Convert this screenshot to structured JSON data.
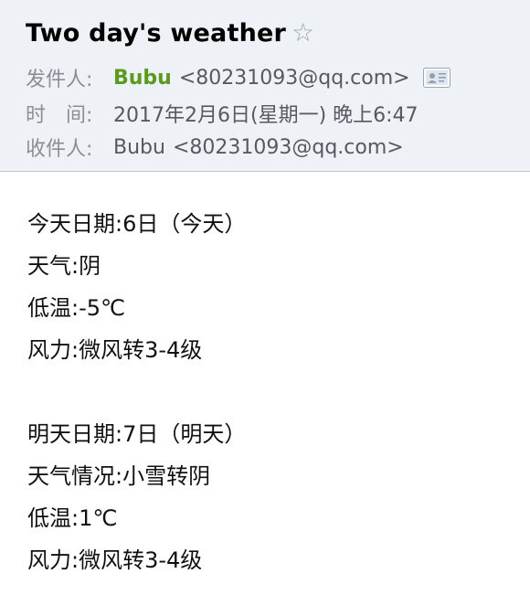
{
  "header": {
    "subject": "Two day's weather",
    "star_icon": "☆",
    "from_label": "发件人:",
    "from_name": "Bubu",
    "from_address": "<80231093@qq.com>",
    "contact_card_icon": "contact-card-icon",
    "time_label": "时　间:",
    "time_value": "2017年2月6日(星期一) 晚上6:47",
    "to_label": "收件人:",
    "to_name": "Bubu",
    "to_address": "<80231093@qq.com>"
  },
  "body": {
    "today": [
      "今天日期:6日（今天）",
      "天气:阴",
      "低温:-5℃",
      "风力:微风转3-4级"
    ],
    "tomorrow": [
      "明天日期:7日（明天）",
      "天气情况:小雪转阴",
      "低温:1℃",
      "风力:微风转3-4级"
    ]
  },
  "colors": {
    "header_bg": "#eef2f7",
    "sender_green": "#5a9a1e",
    "label_gray": "#8a8f96"
  }
}
